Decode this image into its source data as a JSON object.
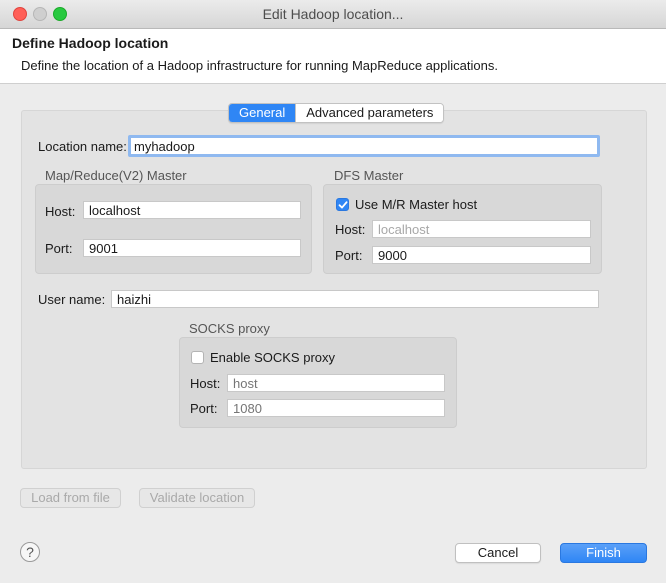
{
  "window": {
    "title": "Edit Hadoop location..."
  },
  "header": {
    "title": "Define Hadoop location",
    "description": "Define the location of a Hadoop infrastructure for running MapReduce applications."
  },
  "tabs": [
    {
      "label": "General",
      "active": true
    },
    {
      "label": "Advanced parameters",
      "active": false
    }
  ],
  "location": {
    "label": "Location name:",
    "value": "myhadoop"
  },
  "mr_master": {
    "title": "Map/Reduce(V2) Master",
    "host_label": "Host:",
    "host_value": "localhost",
    "port_label": "Port:",
    "port_value": "9001"
  },
  "dfs_master": {
    "title": "DFS Master",
    "use_mr_label": "Use M/R Master host",
    "use_mr_checked": true,
    "host_label": "Host:",
    "host_value": "localhost",
    "port_label": "Port:",
    "port_value": "9000"
  },
  "user": {
    "label": "User name:",
    "value": "haizhi"
  },
  "socks": {
    "title": "SOCKS proxy",
    "enable_label": "Enable SOCKS proxy",
    "enable_checked": false,
    "host_label": "Host:",
    "host_placeholder": "host",
    "port_label": "Port:",
    "port_placeholder": "1080"
  },
  "buttons": {
    "load": "Load from file",
    "validate": "Validate location",
    "cancel": "Cancel",
    "finish": "Finish"
  },
  "help": {
    "glyph": "?"
  },
  "colors": {
    "accent": "#2f86f5",
    "focus_ring": "#8fb9f0"
  }
}
